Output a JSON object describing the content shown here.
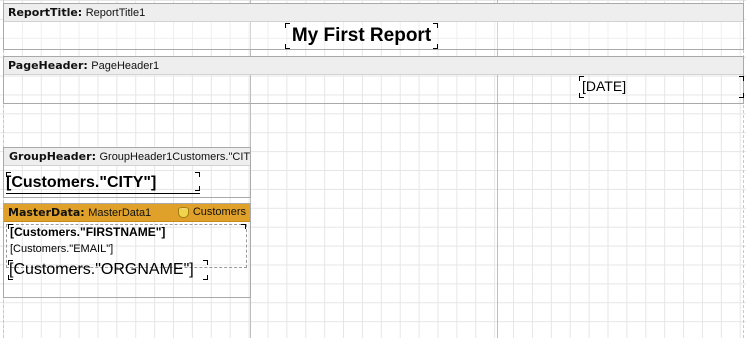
{
  "bands": {
    "report_title": {
      "kind": "ReportTitle:",
      "name": "ReportTitle1",
      "title_text": "My First Report"
    },
    "page_header": {
      "kind": "PageHeader:",
      "name": "PageHeader1",
      "date_text": "[DATE]"
    },
    "group_header": {
      "kind": "GroupHeader:",
      "name": "GroupHeader1",
      "condition": "Customers.\"CITY\"",
      "city_text": "[Customers.\"CITY\"]"
    },
    "master_data": {
      "kind": "MasterData:",
      "name": "MasterData1",
      "datasource": "Customers",
      "datasource_icon": "database-icon",
      "header_color": "#e0a12a",
      "firstname_text": "[Customers.\"FIRSTNAME\"]",
      "email_text": "[Customers.\"EMAIL\"]",
      "orgname_text": "[Customers.\"ORGNAME\"]"
    }
  }
}
